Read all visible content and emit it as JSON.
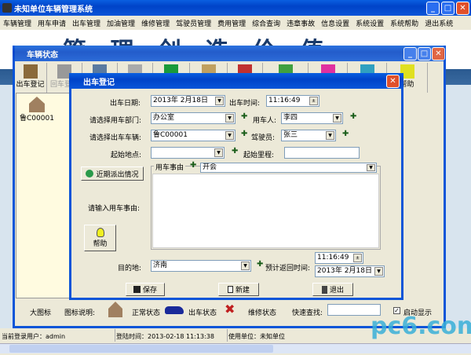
{
  "app": {
    "title": "未知单位车辆管理系统"
  },
  "menu": [
    "车辆管理",
    "用车申请",
    "出车管理",
    "加油管理",
    "维修管理",
    "驾驶员管理",
    "费用管理",
    "综合查询",
    "违章事故",
    "信息设置",
    "系统设置",
    "系统帮助",
    "退出系统"
  ],
  "banner_text": "管 理 创 造 价 值",
  "child": {
    "title": "车辆状态",
    "toolbar": [
      {
        "label": "出车登记",
        "color": "#8a6a3a"
      },
      {
        "label": "回车登记",
        "color": "#999999"
      },
      {
        "label": "",
        "color": "#5a7aa0"
      },
      {
        "label": "",
        "color": "#aaaaaa"
      },
      {
        "label": "",
        "color": "#1a9a3a"
      },
      {
        "label": "",
        "color": "#c0a060"
      },
      {
        "label": "",
        "color": "#c03030"
      },
      {
        "label": "",
        "color": "#40a040"
      },
      {
        "label": "",
        "color": "#e030a0"
      },
      {
        "label": "",
        "color": "#30a0c0"
      },
      {
        "label": "帮助",
        "color": "#e0e020"
      }
    ],
    "vehicle": "鲁C00001",
    "legend": {
      "large_icons": "大图标",
      "legend_label": "图标说明:",
      "normal": "正常状态",
      "out": "出车状态",
      "repair": "维修状态",
      "search_label": "快速查找:",
      "search_value": "",
      "autoshow": "启动显示",
      "autoshow_checked": true
    }
  },
  "dialog": {
    "title": "出车登记",
    "date_label": "出车日期:",
    "date_value": "2013年  2月18日",
    "date_year_sel": "2013",
    "time_label": "出车时间:",
    "time_value": "11:16:49",
    "dept_label": "请选择用车部门:",
    "dept_value": "办公室",
    "user_label": "用车人:",
    "user_value": "李四",
    "vehicle_label": "请选择出车车辆:",
    "vehicle_value": "鲁C00001",
    "driver_label": "驾驶员:",
    "driver_value": "张三",
    "start_label": "起始地点:",
    "start_value": "",
    "mileage_label": "起始里程:",
    "mileage_value": "",
    "recent_button": "近期派出情况",
    "reason_group": "用车事由",
    "reason_value": "开会",
    "reason_input_label": "请输入用车事由:",
    "reason_text": "",
    "help_button": "帮助",
    "dest_label": "目的地:",
    "dest_value": "济南",
    "return_label": "预计返回时间:",
    "return_time": "11:16:49",
    "return_date": "2013年  2月18日",
    "save": "保存",
    "new": "新建",
    "exit": "退出"
  },
  "status": {
    "user": "当前登录用户：admin",
    "login": "登陆时间：2013-02-18 11:13:38",
    "unit": "使用单位：未知单位"
  },
  "watermark": "pc6.com"
}
